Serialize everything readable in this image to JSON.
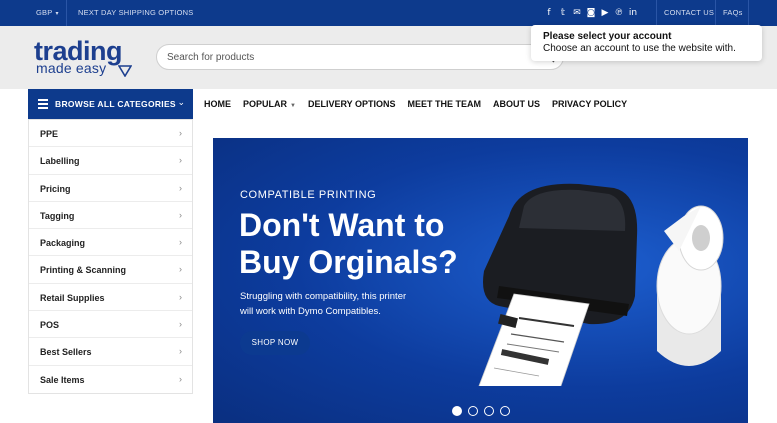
{
  "topbar": {
    "currency": "GBP",
    "shipping_link": "NEXT DAY SHIPPING OPTIONS",
    "social_icons": [
      "facebook-icon",
      "twitter-icon",
      "email-icon",
      "instagram-icon",
      "youtube-icon",
      "pinterest-icon",
      "linkedin-icon"
    ],
    "contact_link": "CONTACT US",
    "faqs_link": "FAQs"
  },
  "header": {
    "logo_line1": "trading",
    "logo_line2": "made easy",
    "search_placeholder": "Search for products"
  },
  "popup": {
    "title": "Please select your account",
    "message": "Choose an account to use the website with."
  },
  "categories": {
    "button_label": "BROWSE ALL CATEGORIES",
    "items": [
      {
        "label": "PPE"
      },
      {
        "label": "Labelling"
      },
      {
        "label": "Pricing"
      },
      {
        "label": "Tagging"
      },
      {
        "label": "Packaging"
      },
      {
        "label": "Printing & Scanning"
      },
      {
        "label": "Retail Supplies"
      },
      {
        "label": "POS"
      },
      {
        "label": "Best Sellers"
      },
      {
        "label": "Sale Items"
      }
    ]
  },
  "nav": {
    "items": [
      {
        "label": "HOME"
      },
      {
        "label": "POPULAR"
      },
      {
        "label": "DELIVERY OPTIONS"
      },
      {
        "label": "MEET THE TEAM"
      },
      {
        "label": "ABOUT US"
      },
      {
        "label": "PRIVACY POLICY"
      }
    ]
  },
  "hero": {
    "kicker": "COMPATIBLE PRINTING",
    "headline": "Don't Want to Buy Orginals?",
    "subtext": "Struggling with compatibility, this printer will work with Dymo Compatibles.",
    "button_label": "SHOP NOW",
    "slide_count": 4,
    "active_slide": 1
  },
  "colors": {
    "brand_blue": "#0d3a8c",
    "hero_blue": "#1d5fd0"
  }
}
